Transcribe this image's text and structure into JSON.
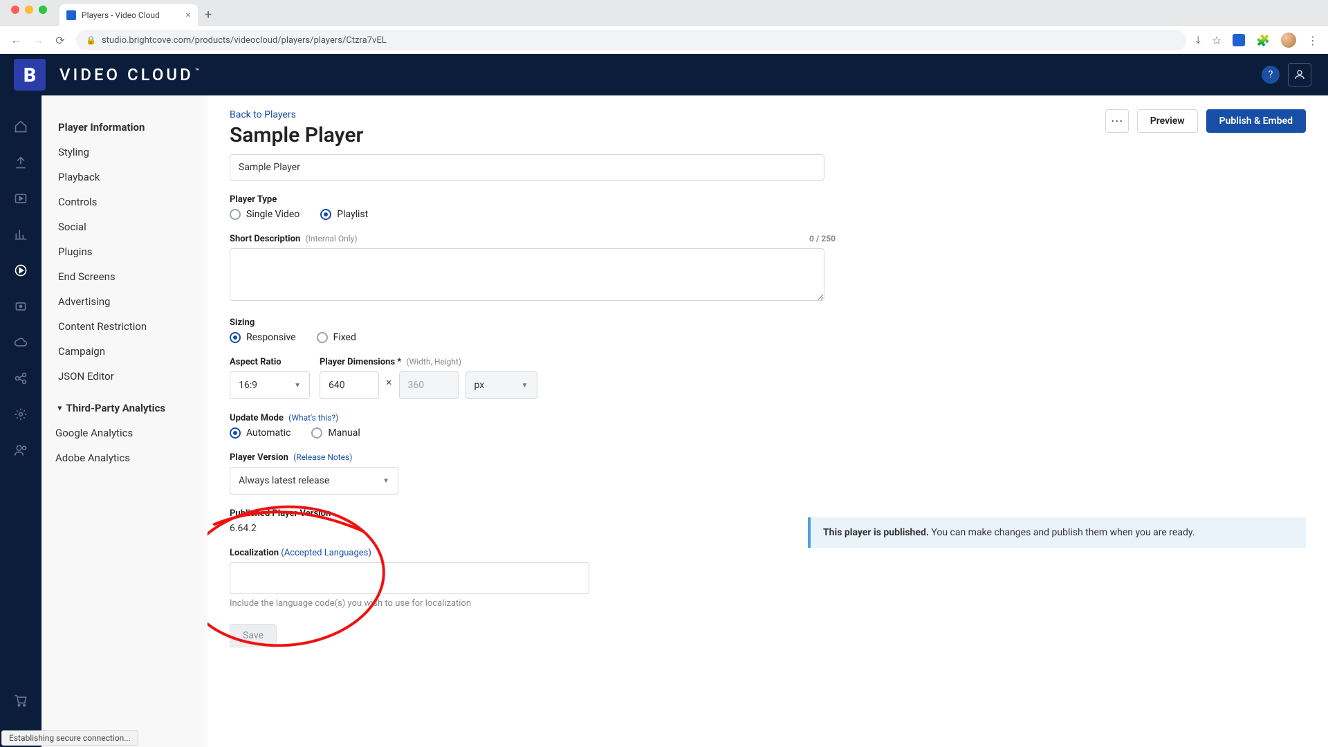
{
  "browser": {
    "tab_title": "Players - Video Cloud",
    "url": "studio.brightcove.com/products/videocloud/players/players/Ctzra7vEL",
    "status": "Establishing secure connection..."
  },
  "app": {
    "product": "VIDEO CLOUD"
  },
  "sidenav": {
    "items": [
      "Player Information",
      "Styling",
      "Playback",
      "Controls",
      "Social",
      "Plugins",
      "End Screens",
      "Advertising",
      "Content Restriction",
      "Campaign",
      "JSON Editor"
    ],
    "group": "Third-Party Analytics",
    "sub": [
      "Google Analytics",
      "Adobe Analytics"
    ]
  },
  "head": {
    "back": "Back to Players",
    "title": "Sample Player",
    "preview": "Preview",
    "publish": "Publish & Embed"
  },
  "form": {
    "name_value": "Sample Player",
    "type_label": "Player Type",
    "type_single": "Single Video",
    "type_playlist": "Playlist",
    "desc_label": "Short Description",
    "desc_hint": "(Internal Only)",
    "desc_counter": "0 / 250",
    "sizing_label": "Sizing",
    "sizing_responsive": "Responsive",
    "sizing_fixed": "Fixed",
    "ar_label": "Aspect Ratio",
    "ar_value": "16:9",
    "dim_label": "Player Dimensions *",
    "dim_hint": "(Width, Height)",
    "dim_w": "640",
    "dim_h": "360",
    "dim_unit": "px",
    "update_label": "Update Mode",
    "update_link": "(What's this?)",
    "update_auto": "Automatic",
    "update_manual": "Manual",
    "ver_label": "Player Version",
    "ver_link": "(Release Notes)",
    "ver_value": "Always latest release",
    "pub_label": "Published Player Version",
    "pub_value": "6.64.2",
    "loc_label": "Localization",
    "loc_link": "(Accepted Languages)",
    "loc_help": "Include the language code(s) you wish to use for localization",
    "save": "Save"
  },
  "banner": {
    "bold": "This player is published.",
    "rest": " You can make changes and publish them when you are ready."
  }
}
